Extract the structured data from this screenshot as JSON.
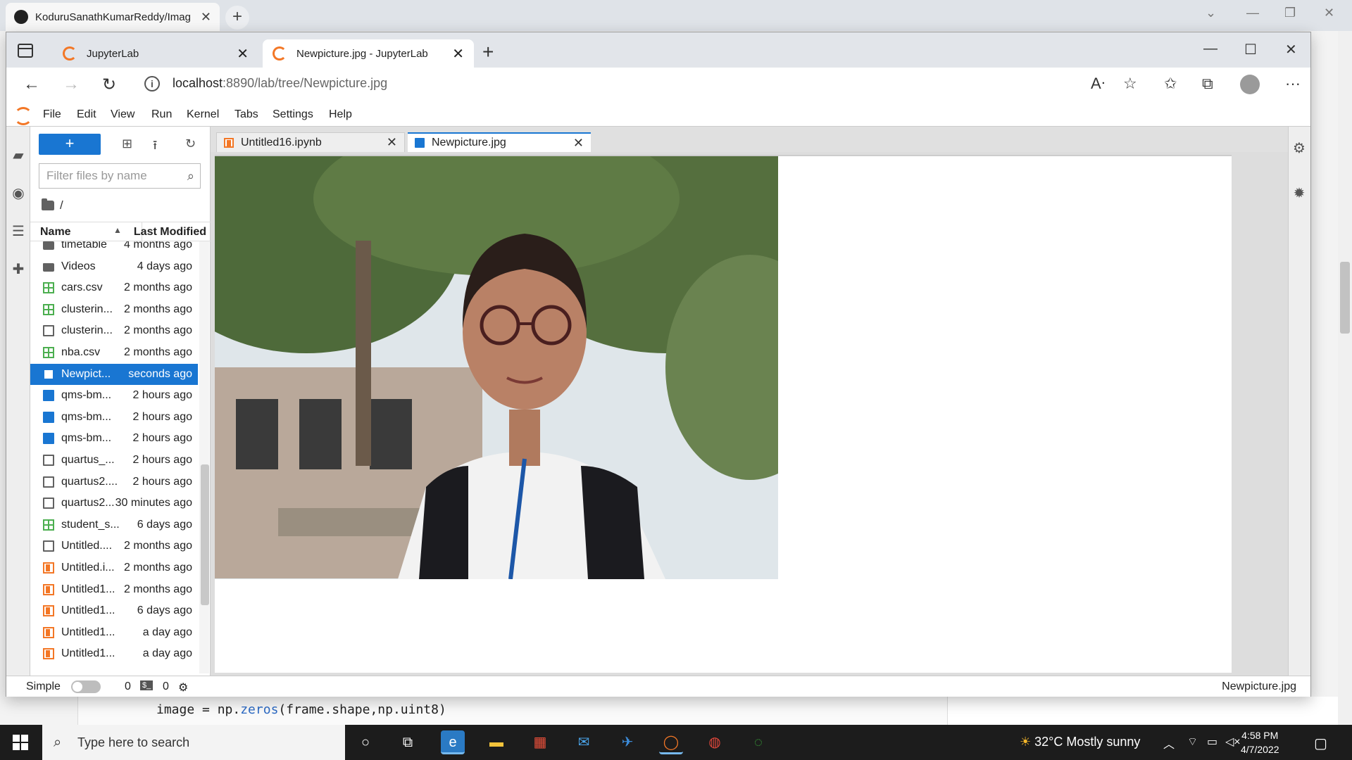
{
  "outer_browser": {
    "tab_title": "KoduruSanathKumarReddy/Imag",
    "tab_close": "✕",
    "new_tab": "+"
  },
  "background_editor": {
    "code_prefix": "image = np.",
    "code_fn": "zeros",
    "code_suffix": "(frame.shape,np.uint8)"
  },
  "browser": {
    "tabs": [
      {
        "title": "JupyterLab",
        "close": "✕"
      },
      {
        "title": "Newpicture.jpg - JupyterLab",
        "close": "✕"
      }
    ],
    "url_host": "localhost",
    "url_rest": ":8890/lab/tree/Newpicture.jpg"
  },
  "jupyter": {
    "menu": [
      "File",
      "Edit",
      "View",
      "Run",
      "Kernel",
      "Tabs",
      "Settings",
      "Help"
    ],
    "new_launcher": "+",
    "filter_placeholder": "Filter files by name",
    "breadcrumb": "/",
    "columns": {
      "name": "Name",
      "modified": "Last Modified"
    },
    "files": [
      {
        "name": "timetable",
        "modified": "4 months ago",
        "type": "folder"
      },
      {
        "name": "Videos",
        "modified": "4 days ago",
        "type": "folder"
      },
      {
        "name": "cars.csv",
        "modified": "2 months ago",
        "type": "csv"
      },
      {
        "name": "clusterin...",
        "modified": "2 months ago",
        "type": "csv"
      },
      {
        "name": "clusterin...",
        "modified": "2 months ago",
        "type": "file"
      },
      {
        "name": "nba.csv",
        "modified": "2 months ago",
        "type": "csv"
      },
      {
        "name": "Newpict...",
        "modified": "seconds ago",
        "type": "image",
        "selected": true
      },
      {
        "name": "qms-bm...",
        "modified": "2 hours ago",
        "type": "image"
      },
      {
        "name": "qms-bm...",
        "modified": "2 hours ago",
        "type": "image"
      },
      {
        "name": "qms-bm...",
        "modified": "2 hours ago",
        "type": "image"
      },
      {
        "name": "quartus_...",
        "modified": "2 hours ago",
        "type": "file"
      },
      {
        "name": "quartus2....",
        "modified": "2 hours ago",
        "type": "file"
      },
      {
        "name": "quartus2....",
        "modified": "30 minutes ago",
        "type": "file"
      },
      {
        "name": "student_s...",
        "modified": "6 days ago",
        "type": "csv"
      },
      {
        "name": "Untitled....",
        "modified": "2 months ago",
        "type": "file"
      },
      {
        "name": "Untitled.i...",
        "modified": "2 months ago",
        "type": "notebook"
      },
      {
        "name": "Untitled1...",
        "modified": "2 months ago",
        "type": "notebook"
      },
      {
        "name": "Untitled1...",
        "modified": "6 days ago",
        "type": "notebook"
      },
      {
        "name": "Untitled1...",
        "modified": "a day ago",
        "type": "notebook"
      },
      {
        "name": "Untitled1...",
        "modified": "a day ago",
        "type": "notebook"
      }
    ],
    "doc_tabs": [
      {
        "title": "Untitled16.ipynb",
        "close": "✕"
      },
      {
        "title": "Newpicture.jpg",
        "close": "✕"
      }
    ],
    "status": {
      "mode": "Simple",
      "terminals": "0",
      "kernels": "0",
      "current_file": "Newpicture.jpg"
    }
  },
  "taskbar": {
    "search_placeholder": "Type here to search",
    "weather": "32°C  Mostly sunny",
    "time": "4:58 PM",
    "date": "4/7/2022"
  },
  "colors": {
    "accent": "#1976d2",
    "jupyter_orange": "#f37726",
    "csv_green": "#4caf50"
  }
}
